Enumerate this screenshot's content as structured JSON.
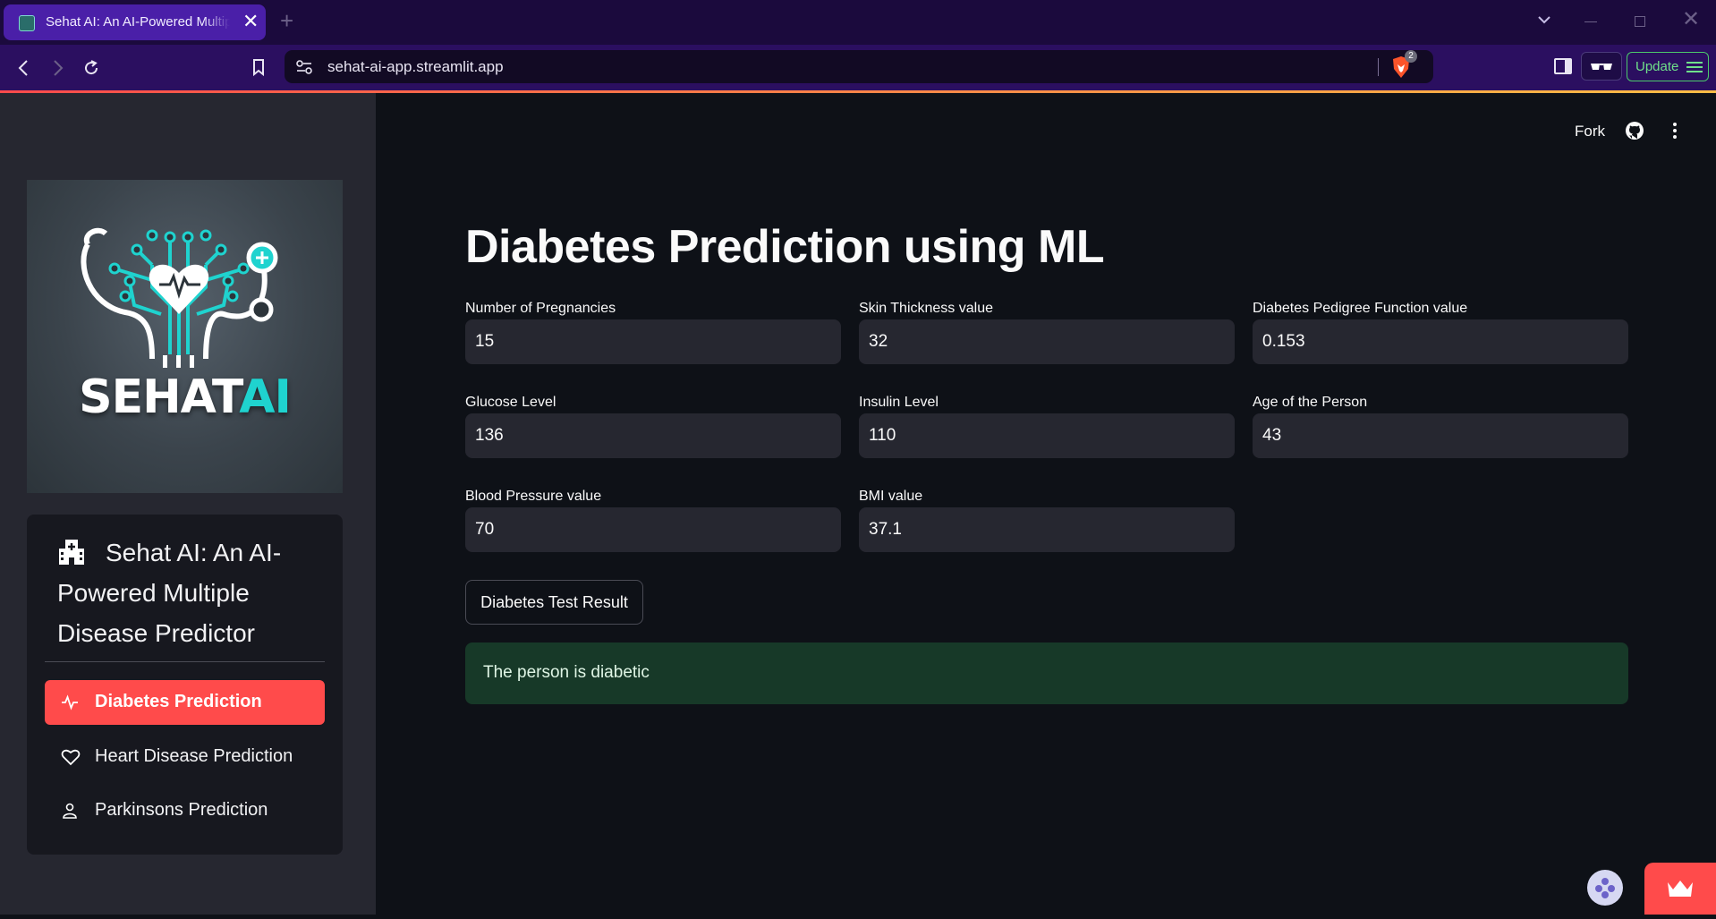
{
  "browser": {
    "tab_title": "Sehat AI: An AI-Powered Multiple Disease Predictor",
    "tab_close": "✕",
    "new_tab": "+",
    "url": "sehat-ai-app.streamlit.app",
    "shield_count": "2",
    "update_label": "Update",
    "window_close": "✕"
  },
  "sidebar": {
    "logo": {
      "wordmark_sehat": "SEHAT",
      "wordmark_ai": "AI"
    },
    "menu_title": "Sehat AI: An AI-Powered Multiple Disease Predictor",
    "items": [
      {
        "label": "Diabetes Prediction",
        "icon": "activity-icon",
        "active": true
      },
      {
        "label": "Heart Disease Prediction",
        "icon": "heart-icon",
        "active": false
      },
      {
        "label": "Parkinsons Prediction",
        "icon": "person-icon",
        "active": false
      }
    ]
  },
  "header": {
    "fork_label": "Fork"
  },
  "main": {
    "title": "Diabetes Prediction using ML",
    "fields": [
      {
        "label": "Number of Pregnancies",
        "value": "15"
      },
      {
        "label": "Skin Thickness value",
        "value": "32"
      },
      {
        "label": "Diabetes Pedigree Function value",
        "value": "0.153"
      },
      {
        "label": "Glucose Level",
        "value": "136"
      },
      {
        "label": "Insulin Level",
        "value": "110"
      },
      {
        "label": "Age of the Person",
        "value": "43"
      },
      {
        "label": "Blood Pressure value",
        "value": "70"
      },
      {
        "label": "BMI value",
        "value": "37.1"
      }
    ],
    "button_label": "Diabetes Test Result",
    "result": "The person is diabetic"
  },
  "colors": {
    "accent": "#ff4b4b",
    "background": "#0e1117",
    "sidebar": "#262730",
    "success_bg": "#173928",
    "browser_chrome": "#2b0f60",
    "logo_teal": "#1fd3cf"
  }
}
